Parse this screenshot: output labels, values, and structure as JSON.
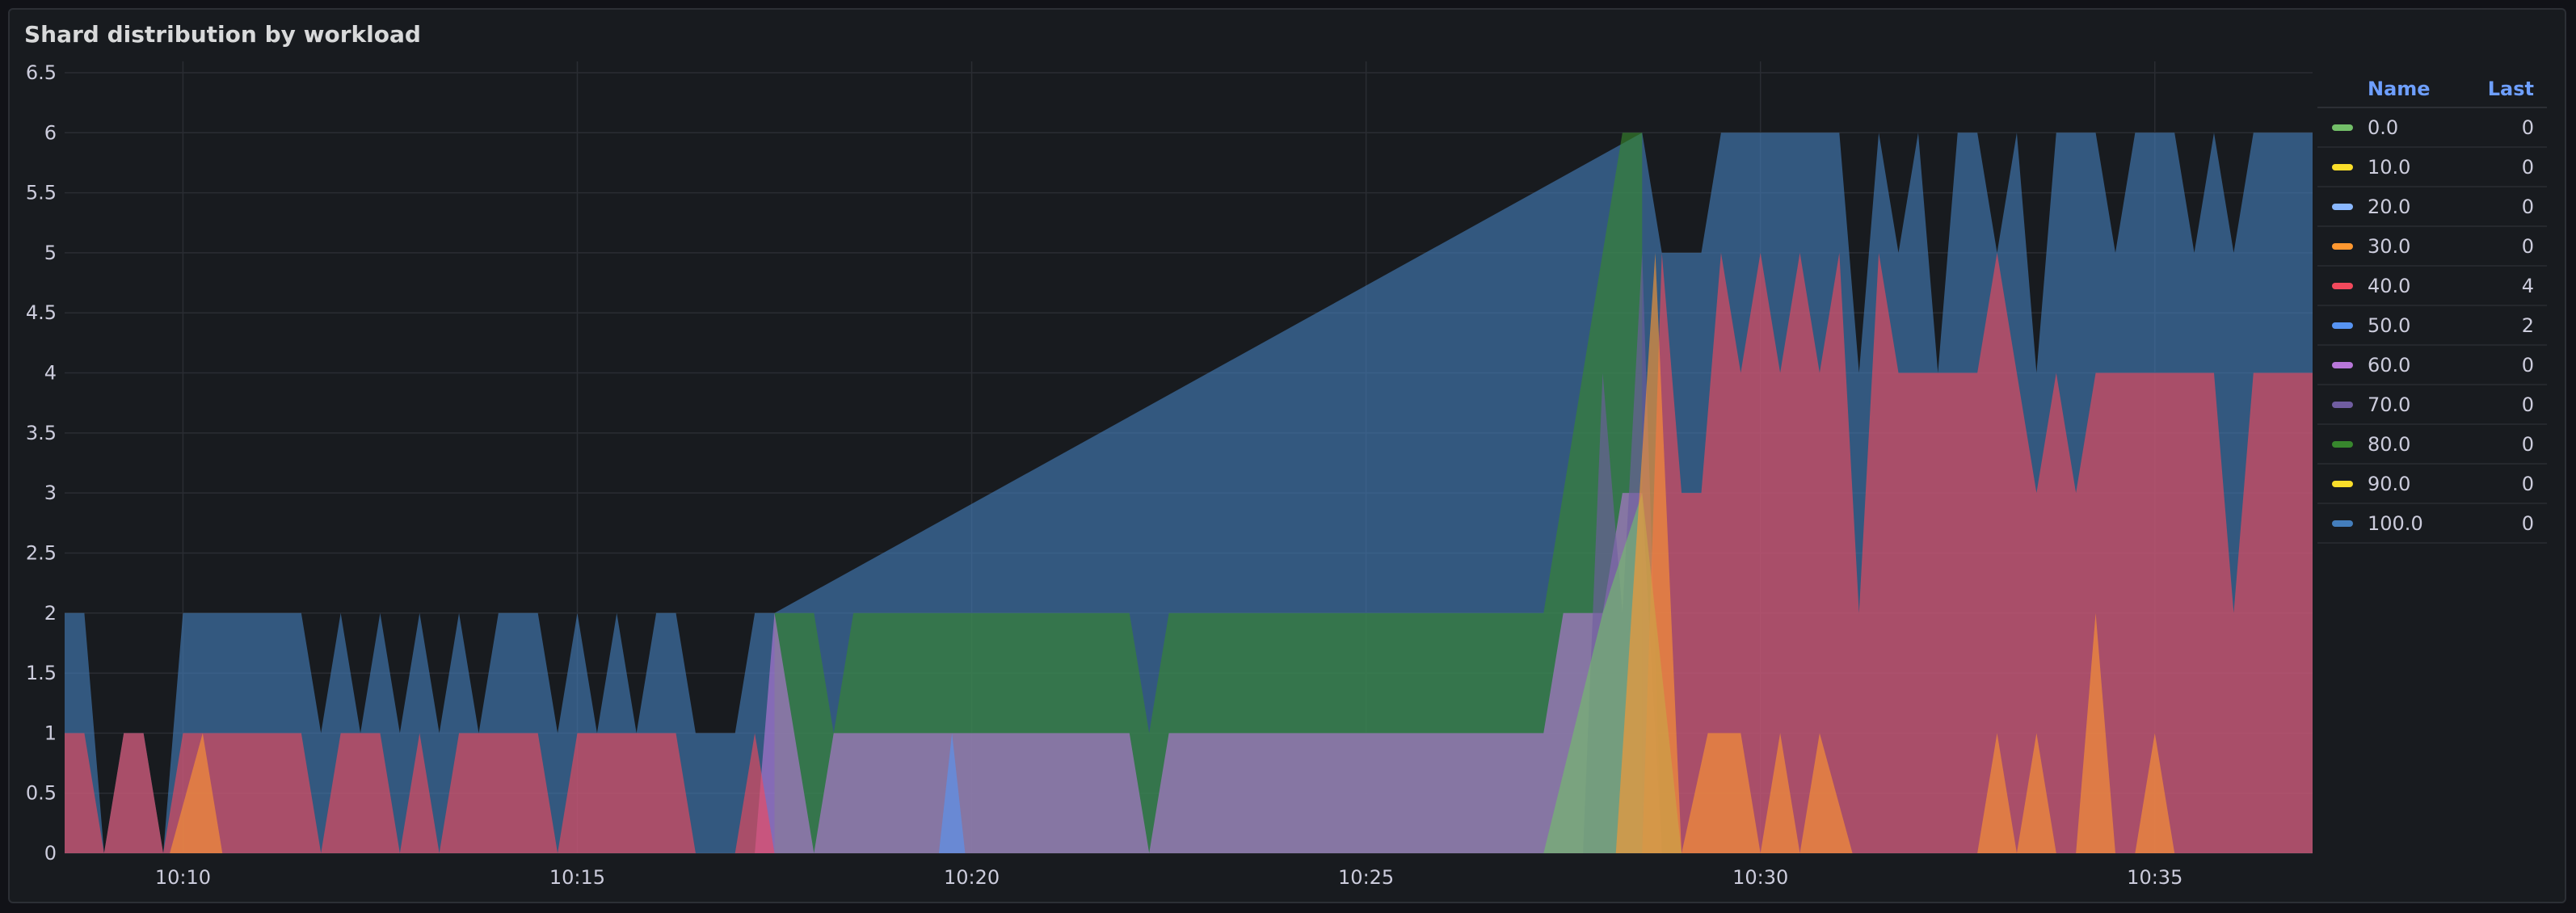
{
  "panel": {
    "title": "Shard distribution by workload"
  },
  "legend": {
    "name_header": "Name",
    "last_header": "Last",
    "items": [
      {
        "name": "0.0",
        "last": "0",
        "color": "#73bf69"
      },
      {
        "name": "10.0",
        "last": "0",
        "color": "#fade2a"
      },
      {
        "name": "20.0",
        "last": "0",
        "color": "#8ab8ff"
      },
      {
        "name": "30.0",
        "last": "0",
        "color": "#ff9830"
      },
      {
        "name": "40.0",
        "last": "4",
        "color": "#f2495c"
      },
      {
        "name": "50.0",
        "last": "2",
        "color": "#5794f2"
      },
      {
        "name": "60.0",
        "last": "0",
        "color": "#b877d9"
      },
      {
        "name": "70.0",
        "last": "0",
        "color": "#705da0"
      },
      {
        "name": "80.0",
        "last": "0",
        "color": "#37872d"
      },
      {
        "name": "90.0",
        "last": "0",
        "color": "#fade2a"
      },
      {
        "name": "100.0",
        "last": "0",
        "color": "#447ebc"
      }
    ]
  },
  "chart_data": {
    "type": "area",
    "title": "Shard distribution by workload",
    "xlabel": "",
    "ylabel": "",
    "x_range": [
      "10:08:30",
      "10:37:00"
    ],
    "x_ticks": [
      "10:10",
      "10:15",
      "10:20",
      "10:25",
      "10:30",
      "10:35"
    ],
    "y_ticks": [
      "0",
      "0.5",
      "1",
      "1.5",
      "2",
      "2.5",
      "3",
      "3.5",
      "4",
      "4.5",
      "5",
      "5.5",
      "6",
      "6.5"
    ],
    "ylim": [
      0,
      6.5
    ],
    "grid": true,
    "legend_position": "right",
    "series": [
      {
        "name": "0.0",
        "color": "#73bf69",
        "points": [
          [
            "10:27:15",
            0
          ],
          [
            "10:28:00",
            2
          ],
          [
            "10:28:30",
            3
          ],
          [
            "10:28:50",
            1
          ],
          [
            "10:29:00",
            0
          ]
        ]
      },
      {
        "name": "30.0",
        "color": "#ff9830",
        "points": [
          [
            "10:09:50",
            0
          ],
          [
            "10:10:15",
            1
          ],
          [
            "10:10:30",
            0
          ],
          [
            "10:28:10",
            0
          ],
          [
            "10:28:40",
            5
          ],
          [
            "10:29:00",
            0
          ],
          [
            "10:29:20",
            1
          ],
          [
            "10:29:45",
            1
          ],
          [
            "10:30:00",
            0
          ],
          [
            "10:30:15",
            1
          ],
          [
            "10:30:30",
            0
          ],
          [
            "10:30:45",
            1
          ],
          [
            "10:31:10",
            0
          ],
          [
            "10:32:45",
            0
          ],
          [
            "10:33:00",
            1
          ],
          [
            "10:33:15",
            0
          ],
          [
            "10:33:30",
            1
          ],
          [
            "10:33:45",
            0
          ],
          [
            "10:34:00",
            0
          ],
          [
            "10:34:15",
            2
          ],
          [
            "10:34:30",
            0
          ],
          [
            "10:34:45",
            0
          ],
          [
            "10:35:00",
            1
          ],
          [
            "10:35:15",
            0
          ]
        ]
      },
      {
        "name": "40.0",
        "color": "#f2495c",
        "points": [
          [
            "10:08:30",
            1
          ],
          [
            "10:08:45",
            1
          ],
          [
            "10:09:00",
            0
          ],
          [
            "10:09:15",
            1
          ],
          [
            "10:09:30",
            1
          ],
          [
            "10:09:45",
            0
          ],
          [
            "10:10:00",
            1
          ],
          [
            "10:11:30",
            1
          ],
          [
            "10:11:45",
            0
          ],
          [
            "10:12:00",
            1
          ],
          [
            "10:12:30",
            1
          ],
          [
            "10:12:45",
            0
          ],
          [
            "10:13:00",
            1
          ],
          [
            "10:13:15",
            0
          ],
          [
            "10:13:30",
            1
          ],
          [
            "10:14:30",
            1
          ],
          [
            "10:14:45",
            0
          ],
          [
            "10:15:00",
            1
          ],
          [
            "10:16:15",
            1
          ],
          [
            "10:16:30",
            0
          ],
          [
            "10:17:00",
            0
          ],
          [
            "10:17:15",
            1
          ],
          [
            "10:17:30",
            0
          ],
          [
            "10:28:30",
            0
          ],
          [
            "10:28:45",
            5
          ],
          [
            "10:29:00",
            3
          ],
          [
            "10:29:15",
            3
          ],
          [
            "10:29:30",
            5
          ],
          [
            "10:29:45",
            4
          ],
          [
            "10:30:00",
            5
          ],
          [
            "10:30:15",
            4
          ],
          [
            "10:30:30",
            5
          ],
          [
            "10:30:45",
            4
          ],
          [
            "10:31:00",
            5
          ],
          [
            "10:31:15",
            2
          ],
          [
            "10:31:30",
            5
          ],
          [
            "10:31:45",
            4
          ],
          [
            "10:32:45",
            4
          ],
          [
            "10:33:00",
            5
          ],
          [
            "10:33:15",
            4
          ],
          [
            "10:33:30",
            3
          ],
          [
            "10:33:45",
            4
          ],
          [
            "10:34:00",
            3
          ],
          [
            "10:34:15",
            4
          ],
          [
            "10:34:30",
            4
          ],
          [
            "10:34:45",
            4
          ],
          [
            "10:35:45",
            4
          ],
          [
            "10:36:00",
            2
          ],
          [
            "10:36:15",
            4
          ],
          [
            "10:37:00",
            4
          ]
        ]
      },
      {
        "name": "50.0",
        "color": "#5794f2",
        "points": [
          [
            "10:19:35",
            0
          ],
          [
            "10:19:45",
            1
          ],
          [
            "10:19:55",
            0
          ]
        ]
      },
      {
        "name": "60.0",
        "color": "#b877d9",
        "points": [
          [
            "10:17:15",
            0
          ],
          [
            "10:17:30",
            2
          ],
          [
            "10:17:45",
            1
          ],
          [
            "10:18:00",
            0
          ],
          [
            "10:18:15",
            1
          ],
          [
            "10:22:00",
            1
          ],
          [
            "10:22:15",
            0
          ],
          [
            "10:22:30",
            1
          ],
          [
            "10:27:15",
            1
          ],
          [
            "10:27:30",
            2
          ],
          [
            "10:28:00",
            2
          ],
          [
            "10:28:15",
            3
          ],
          [
            "10:28:30",
            3
          ],
          [
            "10:28:45",
            0
          ]
        ]
      },
      {
        "name": "70.0",
        "color": "#705da0",
        "points": [
          [
            "10:27:45",
            0
          ],
          [
            "10:28:00",
            4
          ],
          [
            "10:28:15",
            2
          ],
          [
            "10:28:30",
            5
          ],
          [
            "10:28:45",
            0
          ]
        ]
      },
      {
        "name": "80.0",
        "color": "#37872d",
        "points": [
          [
            "10:17:30",
            2
          ],
          [
            "10:18:00",
            2
          ],
          [
            "10:18:15",
            1
          ],
          [
            "10:18:30",
            2
          ],
          [
            "10:22:00",
            2
          ],
          [
            "10:22:15",
            1
          ],
          [
            "10:22:30",
            2
          ],
          [
            "10:27:15",
            2
          ],
          [
            "10:28:00",
            5
          ],
          [
            "10:28:15",
            6
          ],
          [
            "10:28:30",
            6
          ]
        ]
      },
      {
        "name": "100.0",
        "color": "#447ebc",
        "points": [
          [
            "10:08:30",
            2
          ],
          [
            "10:08:45",
            2
          ],
          [
            "10:09:00",
            0
          ],
          [
            "10:09:15",
            1
          ],
          [
            "10:09:30",
            1
          ],
          [
            "10:09:45",
            0
          ],
          [
            "10:10:00",
            2
          ],
          [
            "10:11:30",
            2
          ],
          [
            "10:11:45",
            1
          ],
          [
            "10:12:00",
            2
          ],
          [
            "10:12:15",
            1
          ],
          [
            "10:12:30",
            2
          ],
          [
            "10:12:45",
            1
          ],
          [
            "10:13:00",
            2
          ],
          [
            "10:13:15",
            1
          ],
          [
            "10:13:30",
            2
          ],
          [
            "10:13:45",
            1
          ],
          [
            "10:14:00",
            2
          ],
          [
            "10:14:30",
            2
          ],
          [
            "10:14:45",
            1
          ],
          [
            "10:15:00",
            2
          ],
          [
            "10:15:15",
            1
          ],
          [
            "10:15:30",
            2
          ],
          [
            "10:15:45",
            1
          ],
          [
            "10:16:00",
            2
          ],
          [
            "10:16:15",
            2
          ],
          [
            "10:16:30",
            1
          ],
          [
            "10:17:00",
            1
          ],
          [
            "10:17:15",
            2
          ],
          [
            "10:17:30",
            2
          ],
          [
            "10:28:30",
            6
          ],
          [
            "10:28:45",
            5
          ],
          [
            "10:29:00",
            5
          ],
          [
            "10:29:15",
            5
          ],
          [
            "10:29:30",
            6
          ],
          [
            "10:31:00",
            6
          ],
          [
            "10:31:15",
            4
          ],
          [
            "10:31:30",
            6
          ],
          [
            "10:31:45",
            5
          ],
          [
            "10:32:00",
            6
          ],
          [
            "10:32:15",
            4
          ],
          [
            "10:32:30",
            6
          ],
          [
            "10:32:45",
            6
          ],
          [
            "10:33:00",
            5
          ],
          [
            "10:33:15",
            6
          ],
          [
            "10:33:30",
            4
          ],
          [
            "10:33:45",
            6
          ],
          [
            "10:34:15",
            6
          ],
          [
            "10:34:30",
            5
          ],
          [
            "10:34:45",
            6
          ],
          [
            "10:35:15",
            6
          ],
          [
            "10:35:30",
            5
          ],
          [
            "10:35:45",
            6
          ],
          [
            "10:36:00",
            5
          ],
          [
            "10:36:15",
            6
          ],
          [
            "10:37:00",
            6
          ]
        ]
      }
    ]
  }
}
